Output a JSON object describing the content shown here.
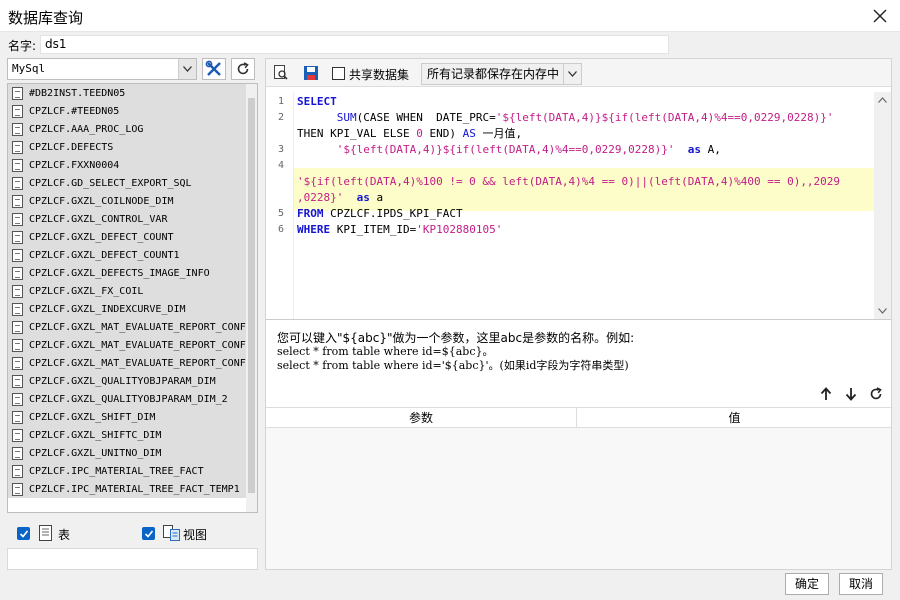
{
  "window": {
    "title": "数据库查询"
  },
  "name_row": {
    "label": "名字:",
    "value": "ds1"
  },
  "left": {
    "db_select": "MySql",
    "tables": [
      "#DB2INST.TEEDN05",
      "CPZLCF.#TEEDN05",
      "CPZLCF.AAA_PROC_LOG",
      "CPZLCF.DEFECTS",
      "CPZLCF.FXXN0004",
      "CPZLCF.GD_SELECT_EXPORT_SQL",
      "CPZLCF.GXZL_COILNODE_DIM",
      "CPZLCF.GXZL_CONTROL_VAR",
      "CPZLCF.GXZL_DEFECT_COUNT",
      "CPZLCF.GXZL_DEFECT_COUNT1",
      "CPZLCF.GXZL_DEFECTS_IMAGE_INFO",
      "CPZLCF.GXZL_FX_COIL",
      "CPZLCF.GXZL_INDEXCURVE_DIM",
      "CPZLCF.GXZL_MAT_EVALUATE_REPORT_CONF",
      "CPZLCF.GXZL_MAT_EVALUATE_REPORT_CONF",
      "CPZLCF.GXZL_MAT_EVALUATE_REPORT_CONF",
      "CPZLCF.GXZL_QUALITYOBJPARAM_DIM",
      "CPZLCF.GXZL_QUALITYOBJPARAM_DIM_2",
      "CPZLCF.GXZL_SHIFT_DIM",
      "CPZLCF.GXZL_SHIFTC_DIM",
      "CPZLCF.GXZL_UNITNO_DIM",
      "CPZLCF.IPC_MATERIAL_TREE_FACT",
      "CPZLCF.IPC_MATERIAL_TREE_FACT_TEMP1"
    ],
    "check_table": "表",
    "check_view": "视图"
  },
  "toolbar": {
    "share_label": "共享数据集",
    "mode_value": "所有记录都保存在内存中"
  },
  "editor": {
    "line_numbers": [
      "1",
      "2",
      "3",
      "4",
      "5",
      "6"
    ],
    "l1_kw": "SELECT",
    "l2_indent": "      ",
    "l2_fn": "SUM",
    "l2_a": "(CASE WHEN  DATE_PRC=",
    "l2_str": "'${left(DATA,4)}${if(left(DATA,4)%4==0,0229,0228)}'",
    "l2b_a": "THEN KPI_VAL ELSE ",
    "l2b_num": "0",
    "l2b_b": " END) ",
    "l2b_as": "AS",
    "l2b_c": " 一月值,",
    "l3_indent": "      ",
    "l3_str": "'${left(DATA,4)}${if(left(DATA,4)%4==0,0229,0228)}'",
    "l3_as": "as",
    "l3_c": " A,",
    "l4_str1": "'${if(left(DATA,4)%100 != 0 && left(DATA,4)%4 == 0)||(left(DATA,4)%400 == 0),,2029",
    "l4_str2": ",0228}'",
    "l4_as": "as",
    "l4_c": " a",
    "l5_kw": "FROM",
    "l5_c": " CPZLCF.IPDS_KPI_FACT",
    "l6_kw": "WHERE",
    "l6_c": " KPI_ITEM_ID=",
    "l6_str": "'KP102880105'"
  },
  "hint": {
    "line1": "您可以键入\"${abc}\"做为一个参数，这里abc是参数的名称。例如:",
    "line2": "select * from table where id=${abc}。",
    "line3": "select * from table where id='${abc}'。(如果id字段为字符串类型)"
  },
  "params_table": {
    "col_param": "参数",
    "col_value": "值"
  },
  "buttons": {
    "ok": "确定",
    "cancel": "取消"
  }
}
